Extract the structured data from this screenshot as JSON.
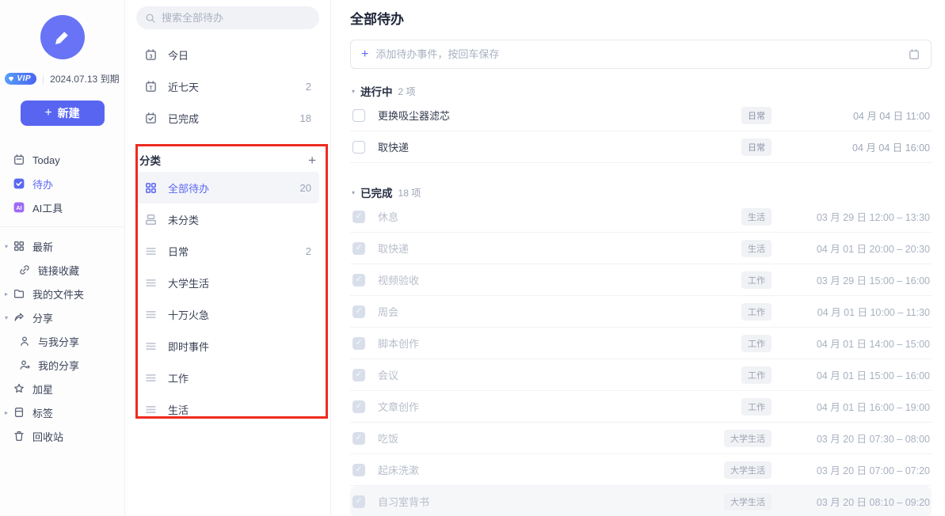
{
  "colors": {
    "accent": "#5b67f1",
    "logo_purple": "#6874f5",
    "ai_purple": "#9d6bf5",
    "vip_blue": "#4a63f2",
    "annotation_red": "#ee2b20",
    "tag_bg": "#f1f2f5",
    "selected_row_bg": "#f4f5f9"
  },
  "sidebar": {
    "vip_label": "VIP",
    "vip_separator": "|",
    "vip_expiry": "2024.07.13 到期",
    "new_button": {
      "plus": "+",
      "label": "新建"
    },
    "primary_items": [
      {
        "label": "Today",
        "icon": "calendar"
      },
      {
        "label": "待办",
        "icon": "todo-check",
        "active": true
      },
      {
        "label": "AI工具",
        "icon": "ai"
      }
    ],
    "secondary_items": [
      {
        "label": "最新",
        "icon": "grid",
        "arrow": "down"
      },
      {
        "label": "链接收藏",
        "icon": "link",
        "child": true
      },
      {
        "label": "我的文件夹",
        "icon": "folder",
        "arrow": "right"
      },
      {
        "label": "分享",
        "icon": "share",
        "arrow": "down"
      },
      {
        "label": "与我分享",
        "icon": "person",
        "child": true
      },
      {
        "label": "我的分享",
        "icon": "person-share",
        "child": true
      },
      {
        "label": "加星",
        "icon": "star"
      },
      {
        "label": "标签",
        "icon": "tag",
        "arrow": "right"
      },
      {
        "label": "回收站",
        "icon": "trash"
      }
    ]
  },
  "panel": {
    "search_placeholder": "搜索全部待办",
    "smart_lists": [
      {
        "label": "今日",
        "icon": "cal-3",
        "count": ""
      },
      {
        "label": "近七天",
        "icon": "cal-t",
        "count": "2"
      },
      {
        "label": "已完成",
        "icon": "cal-check",
        "count": "18"
      }
    ],
    "category_header": "分类",
    "add_category": "+",
    "categories": [
      {
        "label": "全部待办",
        "icon": "grid",
        "count": "20",
        "active": true
      },
      {
        "label": "未分类",
        "icon": "unsorted",
        "count": "",
        "muted": true
      },
      {
        "label": "日常",
        "icon": "list",
        "count": "2"
      },
      {
        "label": "大学生活",
        "icon": "list",
        "count": ""
      },
      {
        "label": "十万火急",
        "icon": "list",
        "count": ""
      },
      {
        "label": "即时事件",
        "icon": "list",
        "count": ""
      },
      {
        "label": "工作",
        "icon": "list",
        "count": ""
      },
      {
        "label": "生活",
        "icon": "list",
        "count": ""
      }
    ]
  },
  "main": {
    "title": "全部待办",
    "add_plus": "+",
    "add_placeholder": "添加待办事件，按回车保存",
    "in_progress": {
      "collapse_glyph": "▾",
      "title": "进行中",
      "count": "2 项",
      "tasks": [
        {
          "name": "更换吸尘器滤芯",
          "tag": "日常",
          "time": "04 月 04 日 11:00"
        },
        {
          "name": "取快递",
          "tag": "日常",
          "time": "04 月 04 日 16:00"
        }
      ]
    },
    "completed": {
      "collapse_glyph": "▾",
      "title": "已完成",
      "count": "18 项",
      "tasks": [
        {
          "name": "休息",
          "tag": "生活",
          "time": "03 月 29 日 12:00 – 13:30"
        },
        {
          "name": "取快递",
          "tag": "生活",
          "time": "04 月 01 日 20:00 – 20:30"
        },
        {
          "name": "视频验收",
          "tag": "工作",
          "time": "03 月 29 日 15:00 – 16:00"
        },
        {
          "name": "周会",
          "tag": "工作",
          "time": "04 月 01 日 10:00 – 11:30"
        },
        {
          "name": "脚本创作",
          "tag": "工作",
          "time": "04 月 01 日 14:00 – 15:00"
        },
        {
          "name": "会议",
          "tag": "工作",
          "time": "04 月 01 日 15:00 – 16:00"
        },
        {
          "name": "文章创作",
          "tag": "工作",
          "time": "04 月 01 日 16:00 – 19:00"
        },
        {
          "name": "吃饭",
          "tag": "大学生活",
          "time": "03 月 20 日 07:30 – 08:00"
        },
        {
          "name": "起床洗漱",
          "tag": "大学生活",
          "time": "03 月 20 日 07:00 – 07:20"
        },
        {
          "name": "自习室背书",
          "tag": "大学生活",
          "time": "03 月 20 日 08:10 – 09:20",
          "highlighted": true
        }
      ]
    }
  }
}
